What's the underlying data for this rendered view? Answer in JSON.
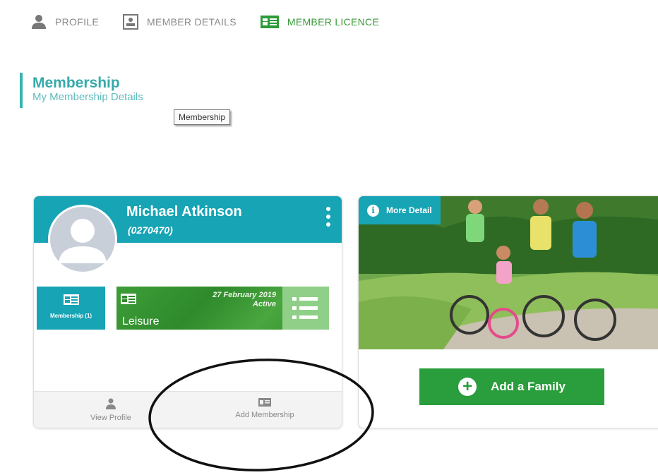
{
  "nav": {
    "items": [
      {
        "label": "PROFILE",
        "icon": "person-icon",
        "active": false
      },
      {
        "label": "MEMBER DETAILS",
        "icon": "id-badge-icon",
        "active": false
      },
      {
        "label": "MEMBER LICENCE",
        "icon": "id-card-icon",
        "active": true
      }
    ]
  },
  "header": {
    "title": "Membership",
    "subtitle": "My Membership Details",
    "tooltip": "Membership"
  },
  "member_card": {
    "name": "Michael Atkinson",
    "member_id": "(0270470)",
    "membership_button_label": "Membership (1)",
    "licence": {
      "date": "27 February 2019",
      "status": "Active",
      "type": "Leisure"
    },
    "footer": {
      "view_profile": "View Profile",
      "add_membership": "Add Membership"
    }
  },
  "family_card": {
    "more_detail": "More Detail",
    "add_family": "Add a Family"
  },
  "colors": {
    "teal": "#17a4b5",
    "green": "#2a9d3c",
    "active_nav": "#3a9a3a"
  }
}
